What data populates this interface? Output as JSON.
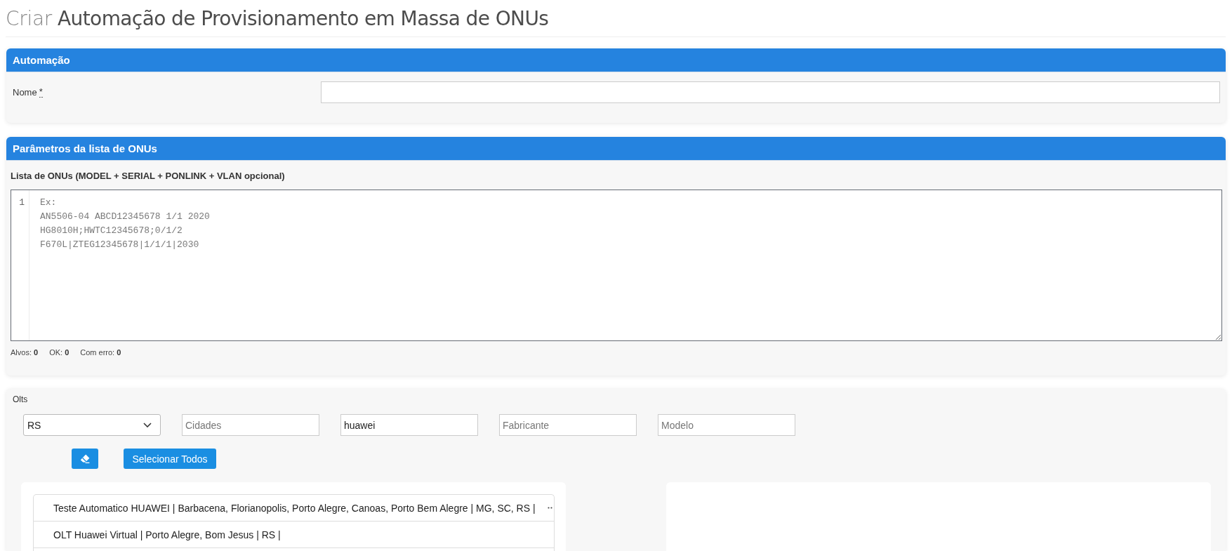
{
  "page": {
    "title_prefix": "Criar",
    "title": "Automação de Provisionamento em Massa de ONUs"
  },
  "automation_panel": {
    "title": "Automação",
    "name_field": {
      "label": "Nome",
      "required_mark": "*"
    }
  },
  "onu_list_panel": {
    "title": "Parâmetros da lista de ONUs",
    "editor": {
      "label": "Lista de ONUs (MODEL + SERIAL + PONLINK + VLAN opcional)",
      "line_numbers": [
        "1"
      ],
      "placeholder": "Ex:\nAN5506-04 ABCD12345678 1/1 2020\nHG8010H;HWTC12345678;0/1/2\nF670L|ZTEG12345678|1/1/1|2030"
    },
    "counters": [
      "Alvos: **0**",
      "OK: **0**",
      "Com erro: **0**"
    ]
  },
  "olts_panel": {
    "label": "Olts",
    "filters": [
      {
        "kind": "select",
        "value": "RS"
      },
      {
        "kind": "input",
        "placeholder": "Cidades"
      },
      {
        "kind": "input",
        "value": "huawei"
      },
      {
        "kind": "input",
        "placeholder": "Fabricante"
      },
      {
        "kind": "input",
        "placeholder": "Modelo"
      }
    ],
    "buttons": [
      {
        "kind": "icon"
      },
      {
        "kind": "text",
        "label": "Selecionar Todos"
      }
    ],
    "olt_list": [
      {
        "text": "Teste Automatico HUAWEI | Barbacena, Florianopolis, Porto Alegre, Canoas, Porto Bem Alegre | MG, SC, RS |",
        "overflow": true
      },
      {
        "text": "OLT Huawei Virtual | Porto Alegre, Bom Jesus | RS |",
        "overflow": false
      }
    ]
  }
}
